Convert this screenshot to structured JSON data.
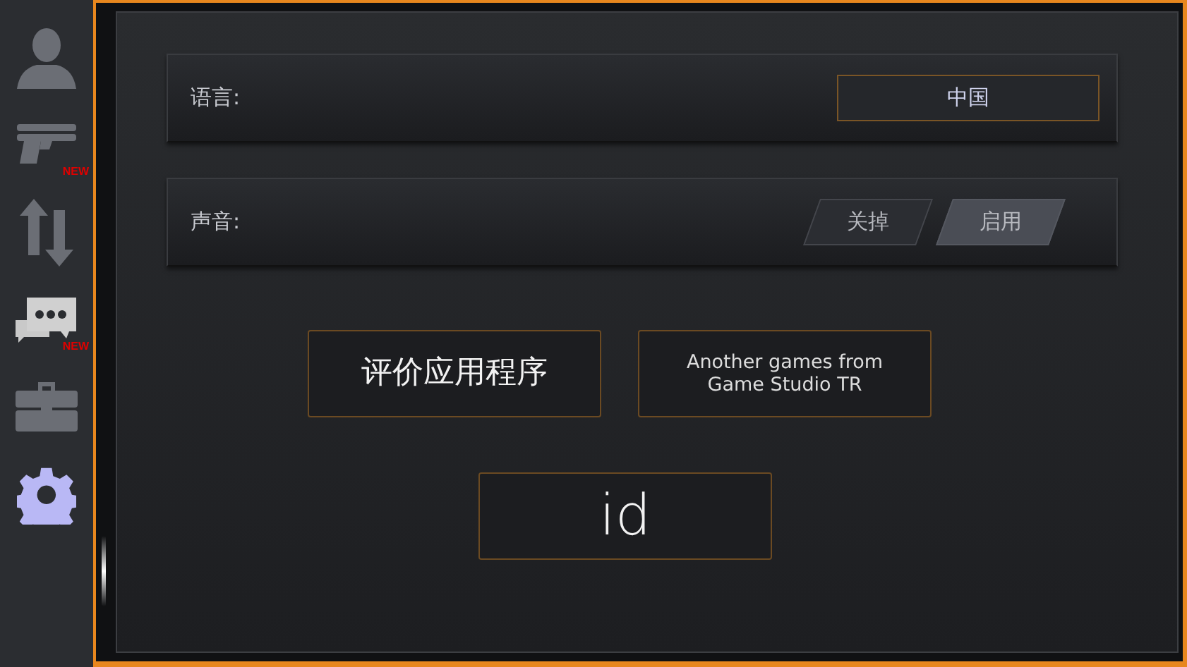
{
  "sidebar": {
    "items": [
      {
        "kind": "profile",
        "selected": false
      },
      {
        "kind": "weapons",
        "badge": "NEW",
        "selected": false
      },
      {
        "kind": "transfer",
        "selected": false
      },
      {
        "kind": "chat",
        "badge": "NEW",
        "selected": false
      },
      {
        "kind": "briefcase",
        "selected": false
      },
      {
        "kind": "settings",
        "selected": true
      }
    ]
  },
  "settings": [
    {
      "kind": "dropdown",
      "label": "语言:",
      "value": "中国"
    },
    {
      "kind": "toggle",
      "label": "声音:",
      "options": [
        {
          "label": "关掉",
          "selected": false
        },
        {
          "label": "启用",
          "selected": true
        }
      ]
    }
  ],
  "buttons": [
    {
      "kind": "rate",
      "label": "评价应用程序"
    },
    {
      "kind": "link",
      "label": "Another games from Game Studio TR"
    }
  ],
  "id_button": {
    "label": "id"
  }
}
